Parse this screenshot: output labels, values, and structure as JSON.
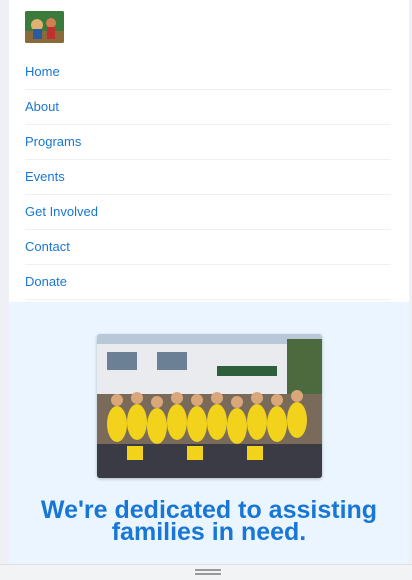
{
  "nav": {
    "items": [
      {
        "label": "Home"
      },
      {
        "label": "About"
      },
      {
        "label": "Programs"
      },
      {
        "label": "Events"
      },
      {
        "label": "Get Involved"
      },
      {
        "label": "Contact"
      },
      {
        "label": "Donate"
      }
    ]
  },
  "hero": {
    "headline": "We're dedicated to assisting families in need.",
    "photo_alt": "Group of volunteers in yellow shirts"
  },
  "colors": {
    "link": "#1877d6",
    "hero_bg": "#eaf5ff"
  }
}
